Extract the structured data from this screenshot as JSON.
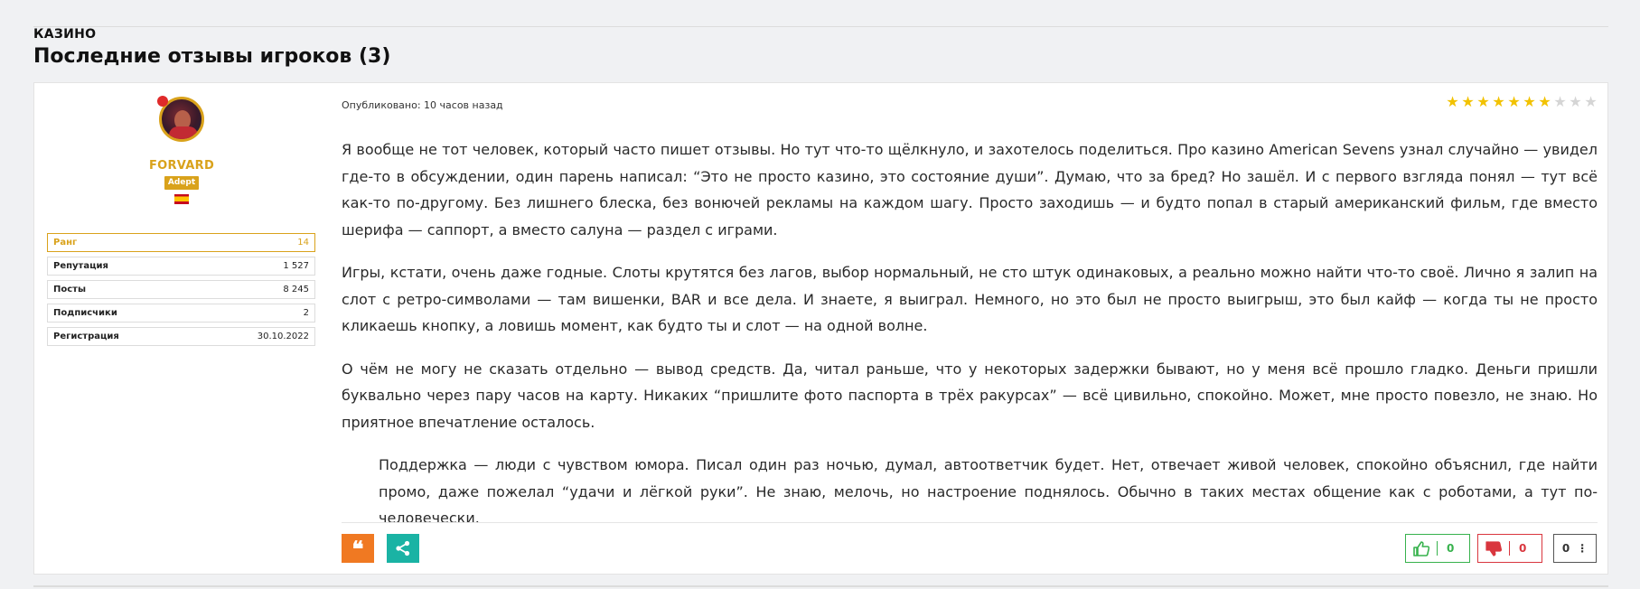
{
  "section": {
    "label": "КАЗИНО",
    "title": "Последние отзывы игроков (3)"
  },
  "author": {
    "username": "FORVARD",
    "role": "Adept",
    "flag_icon": "spain-flag-icon",
    "stats": [
      {
        "label": "Ранг",
        "value": "14"
      },
      {
        "label": "Репутация",
        "value": "1 527"
      },
      {
        "label": "Посты",
        "value": "8 245"
      },
      {
        "label": "Подписчики",
        "value": "2"
      },
      {
        "label": "Регистрация",
        "value": "30.10.2022"
      }
    ]
  },
  "post": {
    "published": "Опубликовано: 10 часов назад",
    "rating": {
      "value": 7,
      "max": 10
    },
    "paragraphs": [
      "Я вообще не тот человек, который часто пишет отзывы. Но тут что-то щёлкнуло, и захотелось поделиться. Про казино American Sevens узнал случайно — увидел где-то в обсуждении, один парень написал: “Это не просто казино, это состояние души”. Думаю, что за бред? Но зашёл. И с первого взгляда понял — тут всё как-то по-другому. Без лишнего блеска, без вонючей рекламы на каждом шагу. Просто заходишь — и будто попал в старый американский фильм, где вместо шерифа — саппорт, а вместо салуна — раздел с играми.",
      "Игры, кстати, очень даже годные. Слоты крутятся без лагов, выбор нормальный, не сто штук одинаковых, а реально можно найти что-то своё. Лично я залип на слот с ретро-символами — там вишенки, BAR и все дела. И знаете, я выиграл. Немного, но это был не просто выигрыш, это был кайф — когда ты не просто кликаешь кнопку, а ловишь момент, как будто ты и слот — на одной волне.",
      "О чём не могу не сказать отдельно — вывод средств. Да, читал раньше, что у некоторых задержки бывают, но у меня всё прошло гладко. Деньги пришли буквально через пару часов на карту. Никаких “пришлите фото паспорта в трёх ракурсах” — всё цивильно, спокойно. Может, мне просто повезло, не знаю. Но приятное впечатление осталось.",
      "Поддержка — люди с чувством юмора. Писал один раз ночью, думал, автоответчик будет. Нет, отвечает живой человек, спокойно объяснил, где найти промо, даже пожелал “удачи и лёгкой руки”. Не знаю, мелочь, но настроение поднялось. Обычно в таких местах общение как с роботами, а тут по-человечески."
    ],
    "actions": {
      "likes": "0",
      "dislikes": "0",
      "score": "0"
    }
  },
  "colors": {
    "accent_gold": "#d9a21b",
    "quote_orange": "#f07922",
    "share_teal": "#1ab3a4",
    "like_green": "#37b24d",
    "dislike_red": "#d9363e",
    "star_yellow": "#f2c200"
  }
}
